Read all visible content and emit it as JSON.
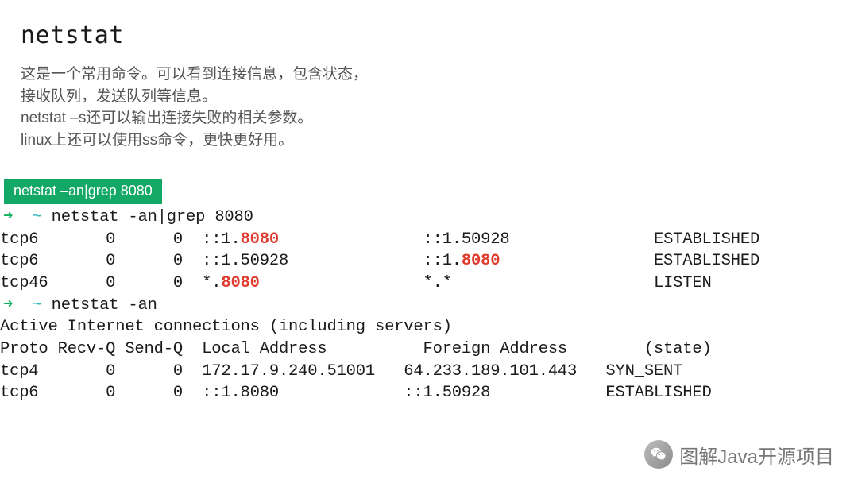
{
  "title": "netstat",
  "description": {
    "line1": "这是一个常用命令。可以看到连接信息，包含状态，",
    "line2": "接收队列，发送队列等信息。",
    "line3": "netstat –s还可以输出连接失败的相关参数。",
    "line4": "linux上还可以使用ss命令，更快更好用。"
  },
  "badge": "netstat –an|grep 8080",
  "terminal": {
    "prompt1": {
      "arrow": "➜",
      "tilde": "~",
      "cmd": "netstat -an|grep 8080"
    },
    "rows1": [
      {
        "proto": "tcp6",
        "recvq": "0",
        "sendq": "0",
        "local_pre": "::1.",
        "local_hl": "8080",
        "local_post": "",
        "foreign_pre": "::1.50928",
        "foreign_hl": "",
        "state": "ESTABLISHED"
      },
      {
        "proto": "tcp6",
        "recvq": "0",
        "sendq": "0",
        "local_pre": "::1.50928",
        "local_hl": "",
        "local_post": "",
        "foreign_pre": "::1.",
        "foreign_hl": "8080",
        "state": "ESTABLISHED"
      },
      {
        "proto": "tcp46",
        "recvq": "0",
        "sendq": "0",
        "local_pre": "*.",
        "local_hl": "8080",
        "local_post": "",
        "foreign_pre": "*.*",
        "foreign_hl": "",
        "state": "LISTEN"
      }
    ],
    "prompt2": {
      "arrow": "➜",
      "tilde": "~",
      "cmd": "netstat -an"
    },
    "header_line": "Active Internet connections (including servers)",
    "columns_line": "Proto Recv-Q Send-Q  Local Address          Foreign Address        (state)",
    "rows2": [
      {
        "proto": "tcp4",
        "recvq": "0",
        "sendq": "0",
        "local": "172.17.9.240.51001",
        "foreign": "64.233.189.101.443",
        "state": "SYN_SENT"
      },
      {
        "proto": "tcp6",
        "recvq": "0",
        "sendq": "0",
        "local": "::1.8080",
        "foreign": "::1.50928",
        "state": "ESTABLISHED"
      }
    ]
  },
  "footer": "图解Java开源项目"
}
